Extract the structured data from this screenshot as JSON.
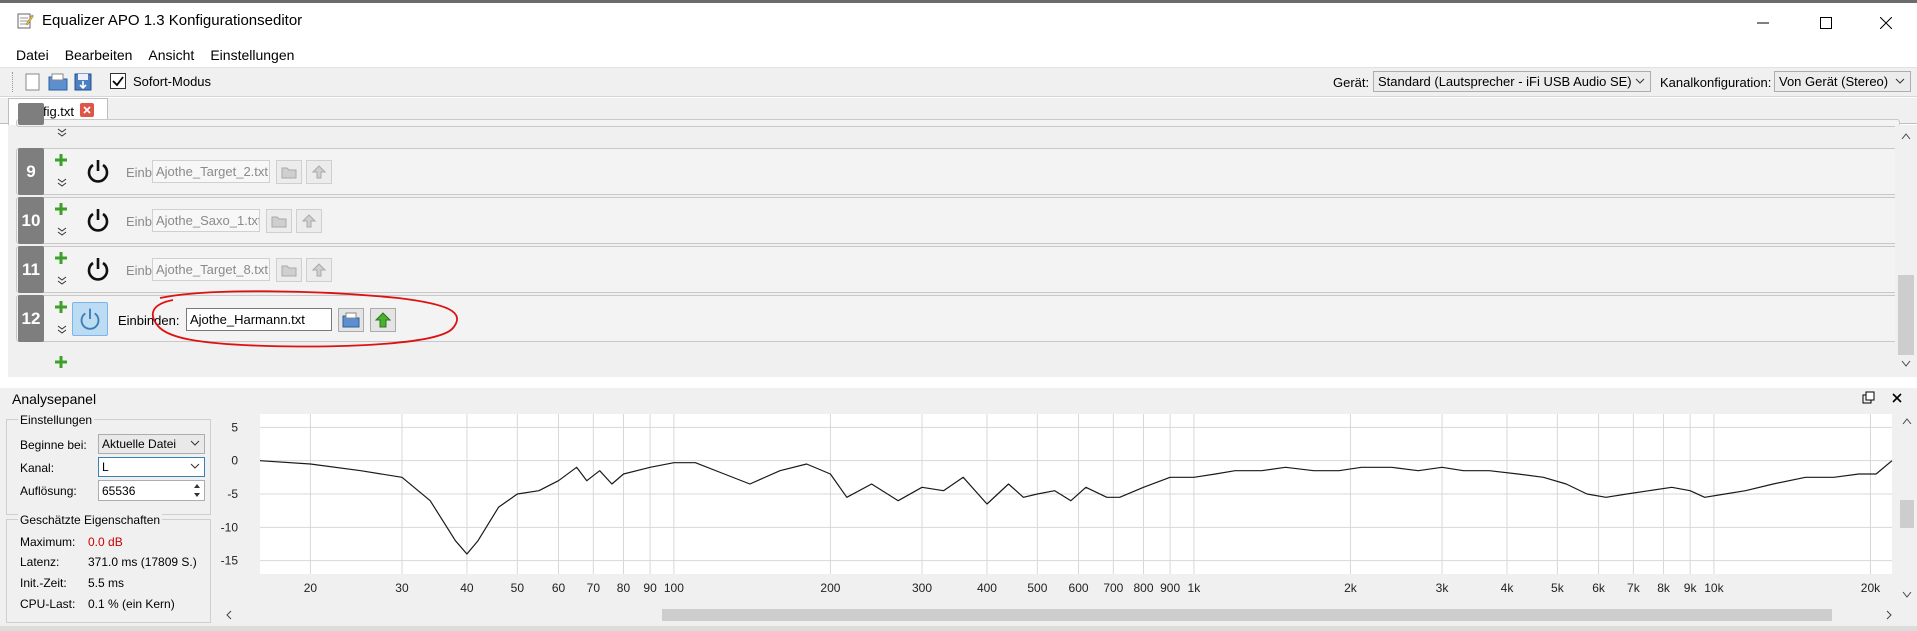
{
  "window": {
    "title": "Equalizer APO 1.3 Konfigurationseditor"
  },
  "menu": [
    "Datei",
    "Bearbeiten",
    "Ansicht",
    "Einstellungen"
  ],
  "toolbar": {
    "instant_mode_label": "Sofort-Modus",
    "instant_mode_checked": true,
    "device_label": "Gerät:",
    "device_value": "Standard (Lautsprecher - iFi USB Audio SE)",
    "channel_config_label": "Kanalkonfiguration:",
    "channel_config_value": "Von Gerät (Stereo)"
  },
  "tabs": [
    {
      "label": "config.txt"
    }
  ],
  "rows": [
    {
      "number": "9",
      "label": "Einbinden:",
      "file": "Ajothe_Target_2.txt",
      "active": false
    },
    {
      "number": "10",
      "label": "Einbinden:",
      "file": "Ajothe_Saxo_1.txt",
      "active": false
    },
    {
      "number": "11",
      "label": "Einbinden:",
      "file": "Ajothe_Target_8.txt",
      "active": false
    },
    {
      "number": "12",
      "label": "Einbinden:",
      "file": "Ajothe_Harmann.txt",
      "active": true
    }
  ],
  "analysis": {
    "title": "Analysepanel",
    "settings": {
      "group_title": "Einstellungen",
      "start_label": "Beginne bei:",
      "start_value": "Aktuelle Datei",
      "channel_label": "Kanal:",
      "channel_value": "L",
      "resolution_label": "Auflösung:",
      "resolution_value": "65536"
    },
    "properties": {
      "group_title": "Geschätzte Eigenschaften",
      "max_label": "Maximum:",
      "max_value": "0.0 dB",
      "latency_label": "Latenz:",
      "latency_value": "371.0 ms (17809 S.)",
      "init_label": "Init.-Zeit:",
      "init_value": "5.5 ms",
      "cpu_label": "CPU-Last:",
      "cpu_value": "0.1 % (ein Kern)"
    }
  },
  "colors": {
    "curve": "#1a1a1a",
    "grid": "#d8d8d8",
    "max_value": "#cc0000",
    "annotation": "#dd1111",
    "row_number_bg": "#7e7e7e"
  },
  "chart_data": {
    "type": "line",
    "x_scale": "log",
    "xlim": [
      16,
      22000
    ],
    "ylim": [
      -17,
      7
    ],
    "y_ticks": [
      "5",
      "0",
      "-5",
      "-10",
      "-15"
    ],
    "x_ticks": [
      "20",
      "30",
      "40",
      "50",
      "60",
      "70",
      "80",
      "90",
      "100",
      "200",
      "300",
      "400",
      "500",
      "600",
      "700",
      "800",
      "900",
      "1k",
      "2k",
      "3k",
      "4k",
      "5k",
      "6k",
      "7k",
      "8k",
      "9k",
      "10k",
      "20k"
    ],
    "series": [
      {
        "x": [
          16,
          20,
          25,
          30,
          34,
          38,
          40,
          42,
          46,
          50,
          55,
          60,
          65,
          68,
          72,
          76,
          80,
          90,
          100,
          110,
          125,
          140,
          160,
          180,
          200,
          215,
          240,
          270,
          300,
          330,
          360,
          400,
          440,
          470,
          500,
          540,
          580,
          620,
          680,
          720,
          800,
          900,
          1000,
          1100,
          1200,
          1350,
          1500,
          1700,
          1900,
          2100,
          2400,
          2700,
          3000,
          3300,
          3700,
          4200,
          4700,
          5200,
          5700,
          6200,
          6800,
          7500,
          8300,
          9000,
          9600,
          10500,
          11500,
          13000,
          15000,
          17000,
          19000,
          20500,
          22000
        ],
        "y": [
          0,
          -0.5,
          -1.5,
          -2.5,
          -6,
          -12,
          -14,
          -12,
          -7,
          -5,
          -4.5,
          -3,
          -1,
          -3,
          -1.5,
          -3.5,
          -2,
          -1,
          -0.3,
          -0.3,
          -2,
          -3.5,
          -1.5,
          -0.5,
          -2,
          -5.5,
          -3.5,
          -6,
          -4,
          -4.5,
          -2.5,
          -6.5,
          -3.5,
          -5.5,
          -5,
          -4.5,
          -6,
          -4,
          -5.5,
          -5.5,
          -4,
          -2.5,
          -2.5,
          -2,
          -1.5,
          -1.5,
          -1,
          -1.5,
          -1.5,
          -1,
          -1,
          -1.5,
          -1,
          -1.5,
          -1.5,
          -2,
          -2.5,
          -3.5,
          -5,
          -5.5,
          -5,
          -4.5,
          -4,
          -4.5,
          -5.5,
          -5,
          -4.5,
          -3.5,
          -2.5,
          -2.5,
          -2,
          -2,
          0
        ]
      }
    ]
  }
}
